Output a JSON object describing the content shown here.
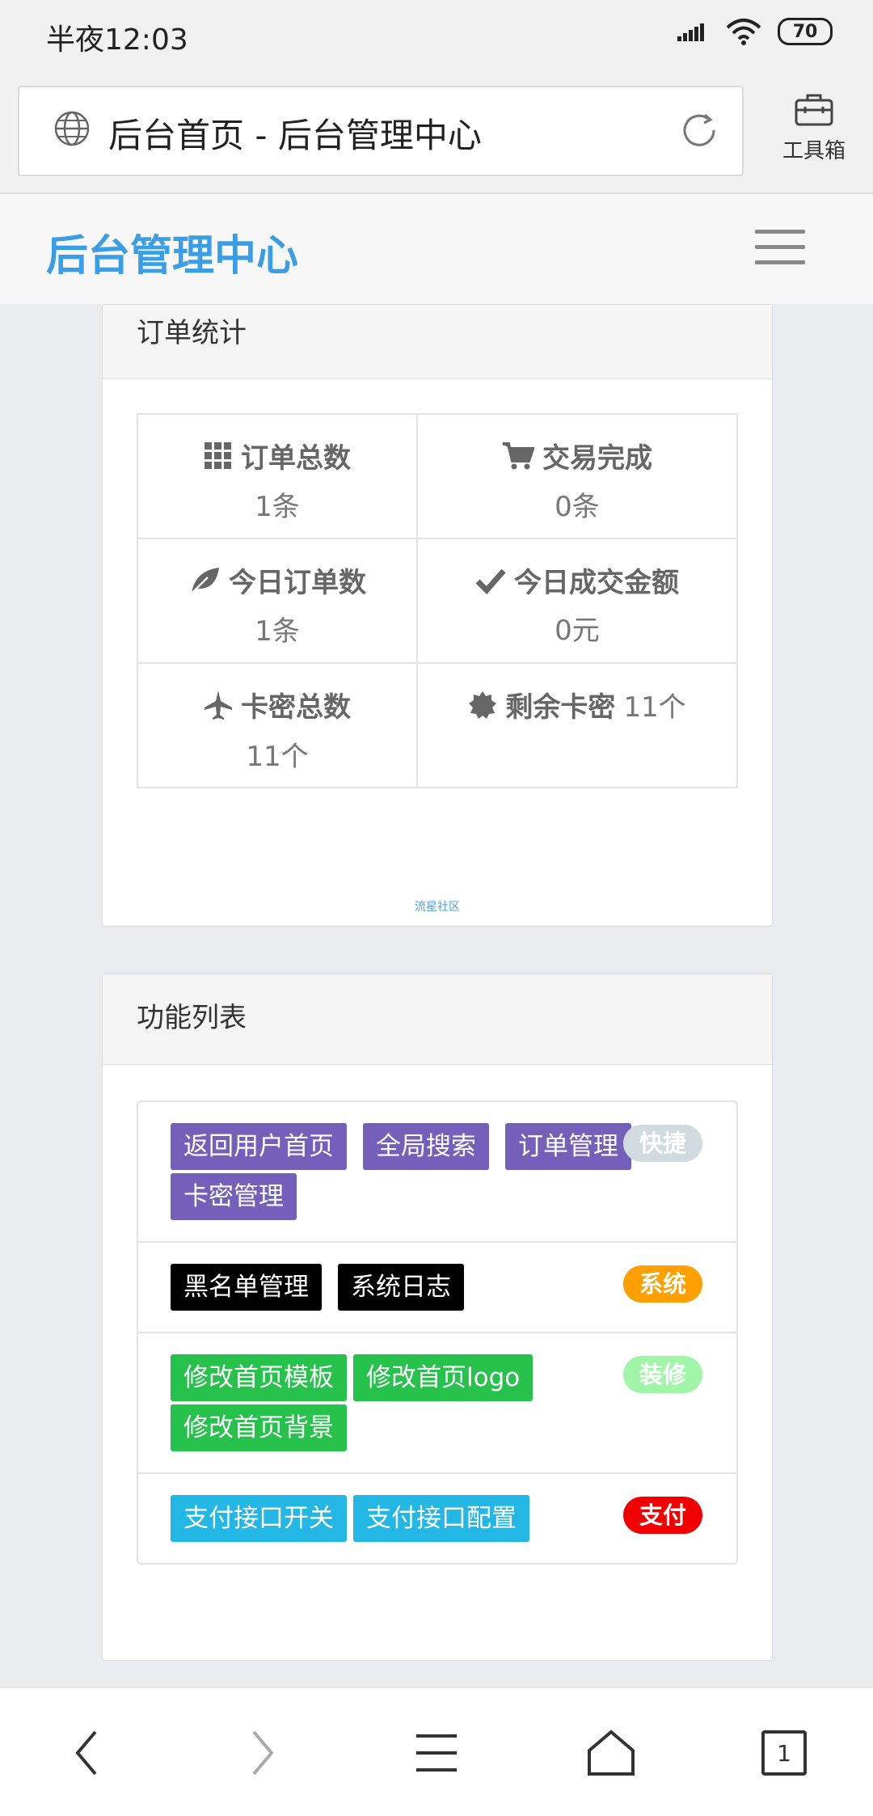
{
  "status_bar": {
    "time": "半夜12:03",
    "battery": "70",
    "icons": [
      "signal-icon",
      "wifi-icon",
      "battery-icon"
    ]
  },
  "browser": {
    "title": "后台首页 - 后台管理中心",
    "toolbox_label": "工具箱"
  },
  "header": {
    "brand": "后台管理中心"
  },
  "orders_panel": {
    "title": "订单统计",
    "stats": [
      {
        "icon": "grid-icon",
        "label": "订单总数",
        "value": "1条"
      },
      {
        "icon": "cart-icon",
        "label": "交易完成",
        "value": "0条"
      },
      {
        "icon": "leaf-icon",
        "label": "今日订单数",
        "value": "1条"
      },
      {
        "icon": "check-icon",
        "label": "今日成交金额",
        "value": "0元"
      },
      {
        "icon": "plane-icon",
        "label": "卡密总数",
        "value": "11个"
      },
      {
        "icon": "certificate-icon",
        "label": "剩余卡密",
        "value": "11个"
      }
    ],
    "watermark": "流星社区"
  },
  "functions_panel": {
    "title": "功能列表",
    "groups": [
      {
        "tag": "快捷",
        "tag_color": "#d1dade",
        "btn_color": "#7460bb",
        "buttons": [
          "返回用户首页",
          "全局搜索",
          "订单管理",
          "卡密管理"
        ]
      },
      {
        "tag": "系统",
        "tag_color": "#ff9f00",
        "btn_color": "#000000",
        "buttons": [
          "黑名单管理",
          "系统日志"
        ]
      },
      {
        "tag": "装修",
        "tag_color": "#a1f5a8",
        "btn_color": "#27c24c",
        "buttons": [
          "修改首页模板",
          "修改首页logo",
          "修改首页背景"
        ]
      },
      {
        "tag": "支付",
        "tag_color": "#f00000",
        "btn_color": "#23b7e5",
        "buttons": [
          "支付接口开关",
          "支付接口配置"
        ]
      }
    ]
  },
  "nav_bar": {
    "tabs_count": "1"
  }
}
